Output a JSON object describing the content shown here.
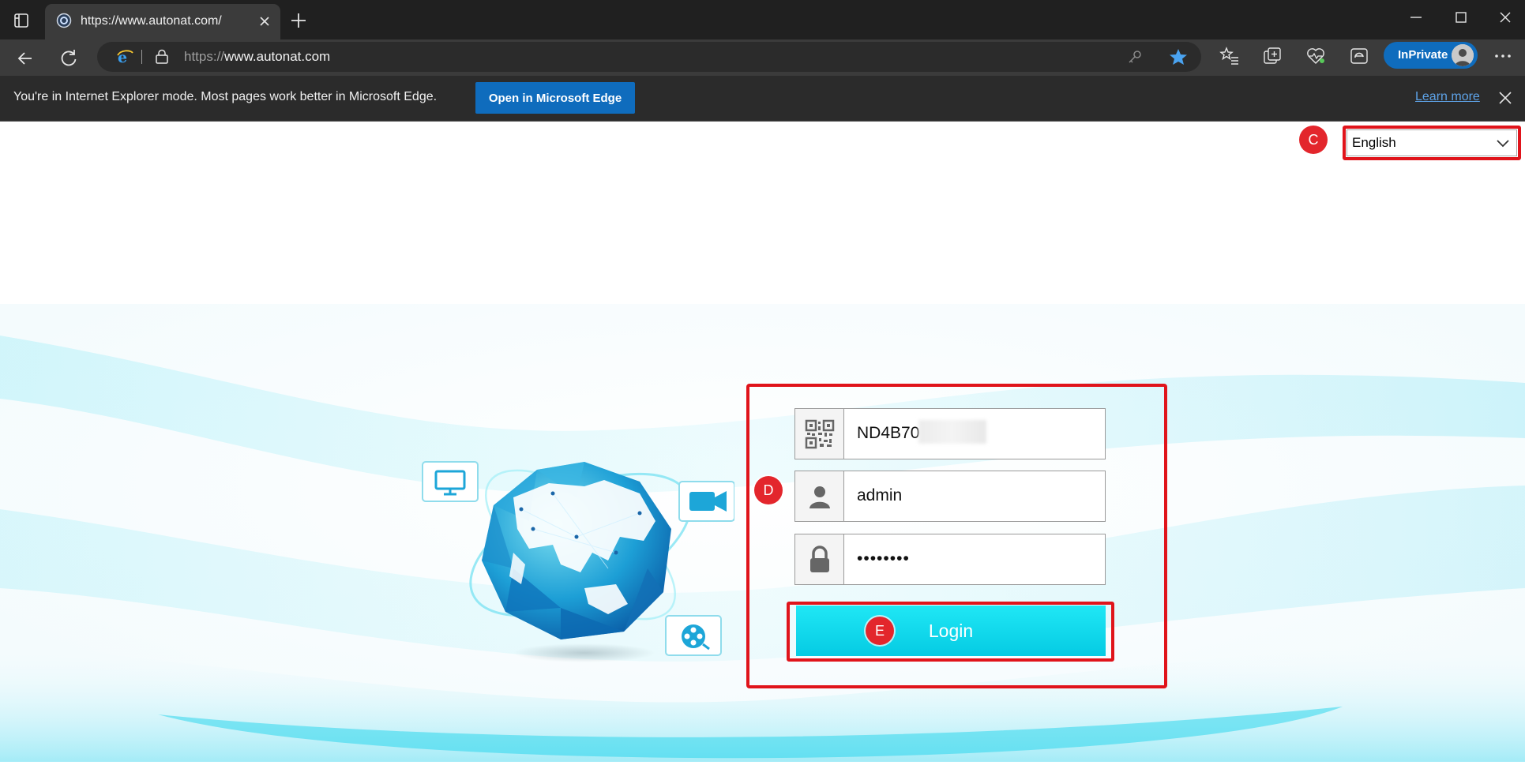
{
  "browser": {
    "tab_title": "https://www.autonat.com/",
    "url_prefix": "https://",
    "url_host": "www.autonat.com",
    "inprivate_label": "InPrivate",
    "infobar_message": "You're in Internet Explorer mode. Most pages work better in Microsoft Edge.",
    "open_in_edge_label": "Open in Microsoft Edge",
    "learn_more_label": "Learn more"
  },
  "page": {
    "language_selected": "English",
    "device_id_visible": "ND4B70",
    "username": "admin",
    "password_masked": "••••••••",
    "login_label": "Login"
  },
  "annotations": {
    "marker_c": "C",
    "marker_d": "D",
    "marker_e": "E"
  },
  "colors": {
    "accent_blue": "#0f6cbd",
    "highlight_red": "#e0141b",
    "login_cyan": "#05cbe3"
  }
}
